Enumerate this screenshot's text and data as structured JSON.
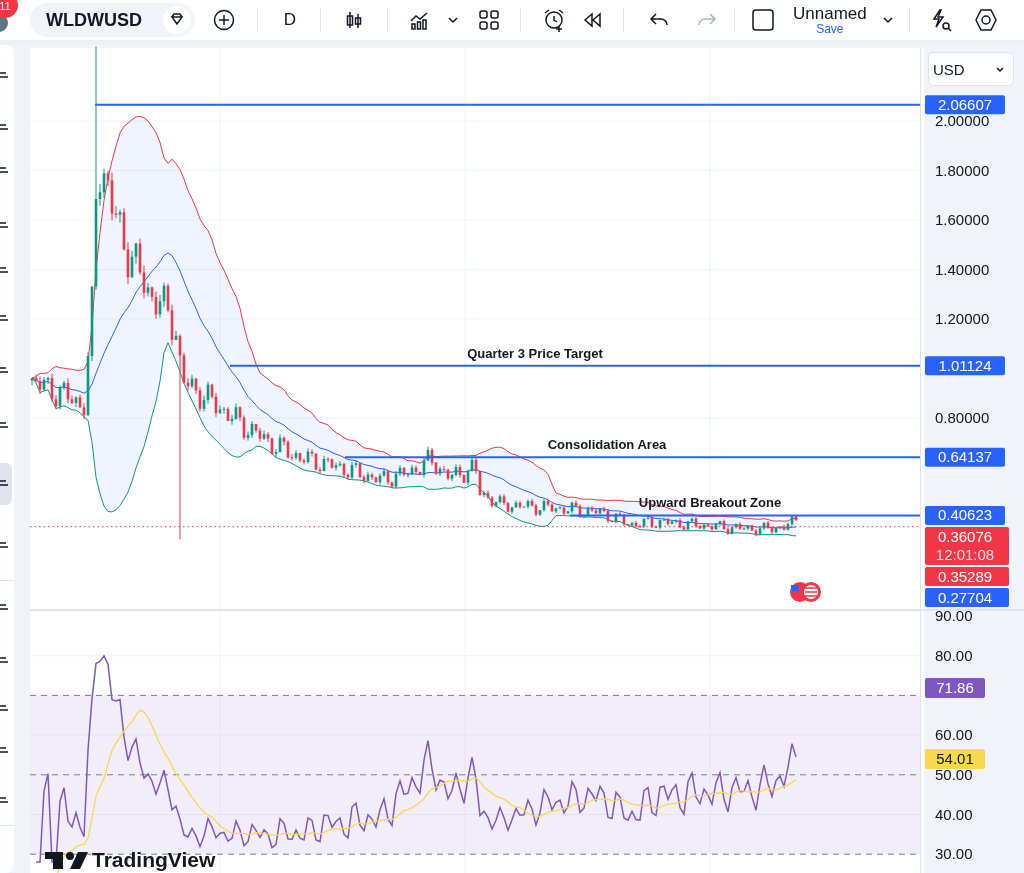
{
  "toolbar": {
    "badge": "11",
    "symbol": "WLDWUSD",
    "interval": "D",
    "layout_name": "Unnamed",
    "save": "Save"
  },
  "currency": "USD",
  "price_axis": {
    "ticks": [
      "2.00000",
      "1.80000",
      "1.60000",
      "1.40000",
      "1.20000",
      "0.80000"
    ]
  },
  "price_lines": [
    {
      "price": "2.06607"
    },
    {
      "price": "1.01124",
      "label": "Quarter 3 Price Target"
    },
    {
      "price": "0.64137",
      "label": "Consolidation Area"
    },
    {
      "price": "0.40623",
      "label": "Upward Breakout Zone"
    }
  ],
  "price_tags": [
    {
      "value": "0.36076",
      "time": "12:01:08",
      "color": "#f23645"
    },
    {
      "value": "0.35289",
      "color": "#f23645"
    },
    {
      "value": "0.27704",
      "color": "#2962ff"
    }
  ],
  "rsi_axis": {
    "ticks": [
      "90.00",
      "80.00",
      "60.00",
      "50.00",
      "40.00",
      "30.00"
    ]
  },
  "rsi_tags": [
    {
      "value": "71.86",
      "color": "#7e57c2"
    },
    {
      "value": "54.01",
      "color": "#f7d94c"
    }
  ],
  "logo": "TradingView"
}
